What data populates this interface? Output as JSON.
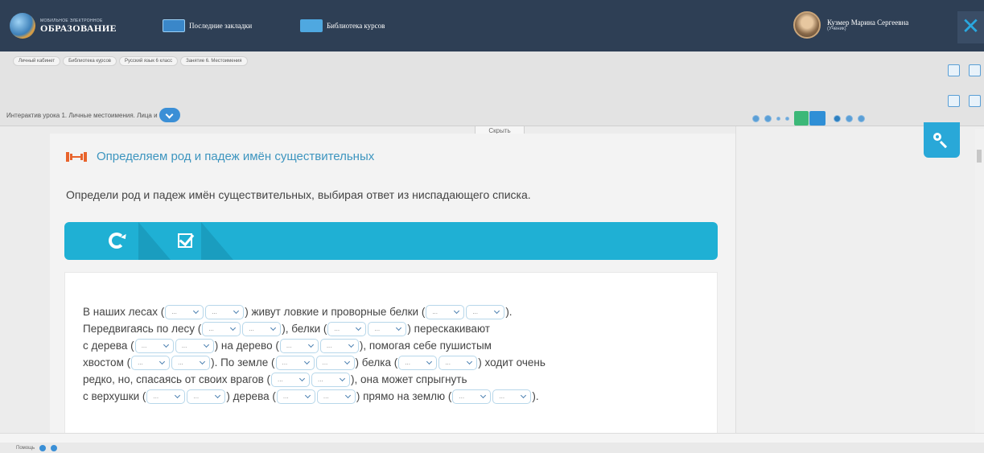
{
  "header": {
    "logo_small": "МОБИЛЬНОЕ ЭЛЕКТРОННОЕ",
    "logo_big": "ОБРАЗОВАНИЕ",
    "nav": [
      {
        "label": "Последние закладки",
        "icon": "bookmarks-icon"
      },
      {
        "label": "Библиотека курсов",
        "icon": "library-icon"
      }
    ],
    "user_name": "Кузмер Марина Сергеевна",
    "user_role": "(Ученик)",
    "close_label": "✕"
  },
  "breadcrumbs": [
    "Личный кабинет",
    "Библиотека курсов",
    "Русский язык 6 класс",
    "Занятие 6. Местоимения"
  ],
  "lesson_select_value": "Интерактив урока 1. Личные местоимения. Лица и",
  "hide_label": "Скрыть",
  "exercise": {
    "title": "Определяем род и падеж имён существительных",
    "instruction": "Определи род и падеж имён существительных, выбирая ответ из ниспадающего списка.",
    "dropdown_placeholder": "...",
    "segments": [
      "В наших лесах (",
      ") живут ловкие и проворные белки (",
      ").",
      "Передвигаясь по лесу (",
      "), белки (",
      ") перескакивают",
      "с дерева (",
      ") на дерево (",
      "), помогая себе пушистым",
      "хвостом (",
      "). По земле (",
      ") белка (",
      ") ходит очень",
      "редко, но, спасаясь от своих врагов (",
      "), она может спрыгнуть",
      "с верхушки (",
      ") дерева (",
      ") прямо на землю (",
      ")."
    ]
  },
  "footer_text": "Помощь"
}
